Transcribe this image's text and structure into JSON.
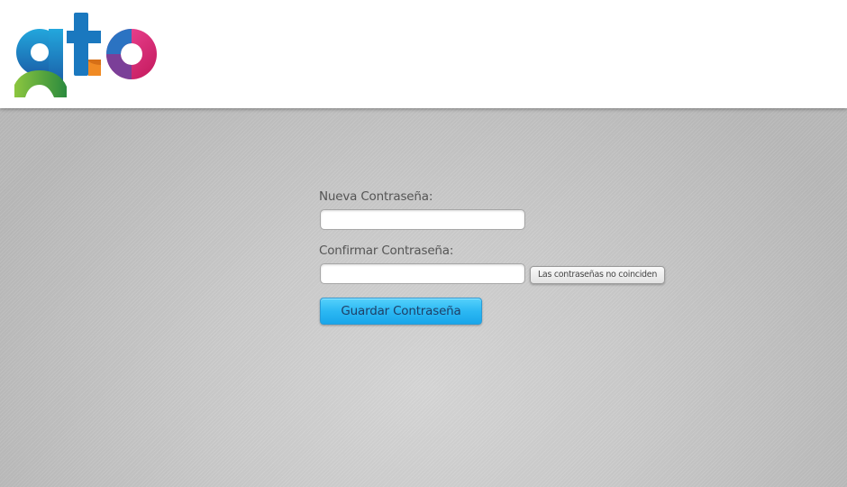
{
  "header": {
    "logo_text": "gto",
    "colors": {
      "blue": "#1f6fb5",
      "green": "#7dbb3c",
      "orange": "#f08a24",
      "magenta": "#e8308a",
      "purple": "#7b3f98"
    }
  },
  "form": {
    "new_password_label": "Nueva Contraseña:",
    "new_password_value": "",
    "confirm_password_label": "Confirmar Contraseña:",
    "confirm_password_value": "",
    "mismatch_message": "Las contraseñas no coinciden",
    "save_label": "Guardar Contraseña"
  },
  "colors": {
    "background": "#c4c4c4",
    "button": "#2cb8f3"
  }
}
